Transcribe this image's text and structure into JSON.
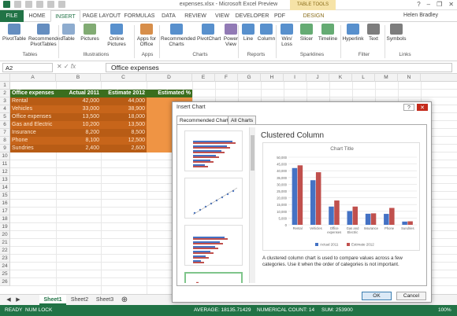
{
  "title": "expenses.xlsx - Microsoft Excel Preview",
  "table_tools": "TABLE TOOLS",
  "user": "Helen Bradley",
  "tabs": [
    "FILE",
    "HOME",
    "INSERT",
    "PAGE LAYOUT",
    "FORMULAS",
    "DATA",
    "REVIEW",
    "VIEW",
    "DEVELOPER",
    "PDF",
    "DESIGN"
  ],
  "ribbon": {
    "buttons": [
      {
        "label": "PivotTable",
        "icon": "pivottable-icon",
        "color": "#4a7ab5"
      },
      {
        "label": "Recommended PivotTables",
        "icon": "recommended-pivottables-icon",
        "color": "#4a7ab5"
      },
      {
        "label": "Table",
        "icon": "table-icon",
        "color": "#7a9ec7"
      },
      {
        "label": "Pictures",
        "icon": "pictures-icon",
        "color": "#6b9c5a"
      },
      {
        "label": "Online Pictures",
        "icon": "online-pictures-icon",
        "color": "#3b7dc4"
      },
      {
        "label": "Apps for Office",
        "icon": "apps-icon",
        "color": "#d07a2a"
      },
      {
        "label": "Recommended Charts",
        "icon": "recommended-charts-icon",
        "color": "#3b7dc4"
      },
      {
        "label": "PivotChart",
        "icon": "pivotchart-icon",
        "color": "#3b7dc4"
      },
      {
        "label": "Power View",
        "icon": "power-view-icon",
        "color": "#7e63a8"
      },
      {
        "label": "Line",
        "icon": "line-sparkline-icon",
        "color": "#3b7dc4"
      },
      {
        "label": "Column",
        "icon": "column-sparkline-icon",
        "color": "#3b7dc4"
      },
      {
        "label": "Win/ Loss",
        "icon": "winloss-sparkline-icon",
        "color": "#3b7dc4"
      },
      {
        "label": "Slicer",
        "icon": "slicer-icon",
        "color": "#4a9c5a"
      },
      {
        "label": "Timeline",
        "icon": "timeline-icon",
        "color": "#4a9c5a"
      },
      {
        "label": "Hyperlink",
        "icon": "hyperlink-icon",
        "color": "#3b7dc4"
      },
      {
        "label": "Text",
        "icon": "text-icon",
        "color": "#666666"
      },
      {
        "label": "Symbols",
        "icon": "symbols-icon",
        "color": "#666666"
      }
    ],
    "groups": [
      "Tables",
      "Illustrations",
      "Apps",
      "Charts",
      "Reports",
      "Sparklines",
      "Filter",
      "Links"
    ]
  },
  "namebox": "A2",
  "formula": "Office expenses",
  "columns": [
    "A",
    "B",
    "C",
    "D",
    "E",
    "F",
    "G",
    "H",
    "I",
    "J",
    "K",
    "L",
    "M",
    "N"
  ],
  "rows": [
    "1",
    "2",
    "3",
    "4",
    "5",
    "6",
    "7",
    "8",
    "9",
    "10",
    "11",
    "12",
    "13",
    "14",
    "15",
    "16",
    "17",
    "18",
    "19",
    "20",
    "21",
    "22",
    "23",
    "24",
    "25",
    "26"
  ],
  "sheet": {
    "header": [
      "Office expenses",
      "Actual 2011",
      "Estimate 2012"
    ],
    "d_header": "Estimated %",
    "data": [
      [
        "Rental",
        "42,000",
        "44,000"
      ],
      [
        "Vehicles",
        "33,000",
        "38,900"
      ],
      [
        "Office expenses",
        "13,500",
        "18,000"
      ],
      [
        "Gas and Electric",
        "10,200",
        "13,500"
      ],
      [
        "Insurance",
        "8,200",
        "8,500"
      ],
      [
        "Phone",
        "8,100",
        "12,500"
      ],
      [
        "Sundries",
        "2,400",
        "2,600"
      ]
    ]
  },
  "sheet_tabs": [
    "Sheet1",
    "Sheet2",
    "Sheet3"
  ],
  "status": {
    "ready": "READY",
    "numlock": "NUM LOCK",
    "average": "AVERAGE: 18135.71429",
    "count": "NUMERICAL COUNT: 14",
    "sum": "SUM: 253900",
    "zoom": "100%"
  },
  "dialog": {
    "title": "Insert Chart",
    "help": "?",
    "close": "✕",
    "tab_recommended": "Recommended Charts",
    "tab_all": "All Charts",
    "chart_name": "Clustered Column",
    "description": "A clustered column chart is used to compare values across a few categories. Use it when the order of categories is not important.",
    "ok": "OK",
    "cancel": "Cancel"
  },
  "chart_data": {
    "type": "bar",
    "title": "Chart Title",
    "categories": [
      "Rental",
      "Vehicles",
      "Office expenses",
      "Gas and Electric",
      "Insurance",
      "Phone",
      "Sundries"
    ],
    "series": [
      {
        "name": "Actual 2011",
        "values": [
          42000,
          33000,
          13500,
          10200,
          8200,
          8100,
          2400
        ],
        "color": "#4472c4"
      },
      {
        "name": "Estimate 2012",
        "values": [
          44000,
          38900,
          18000,
          13500,
          8500,
          12500,
          2600
        ],
        "color": "#c0504d"
      }
    ],
    "ylim": [
      0,
      50000
    ],
    "yticks": [
      "50,000",
      "45,000",
      "40,000",
      "35,000",
      "30,000",
      "25,000",
      "20,000",
      "15,000",
      "10,000",
      "5,000",
      "0"
    ],
    "grid": true,
    "legend": "bottom"
  }
}
